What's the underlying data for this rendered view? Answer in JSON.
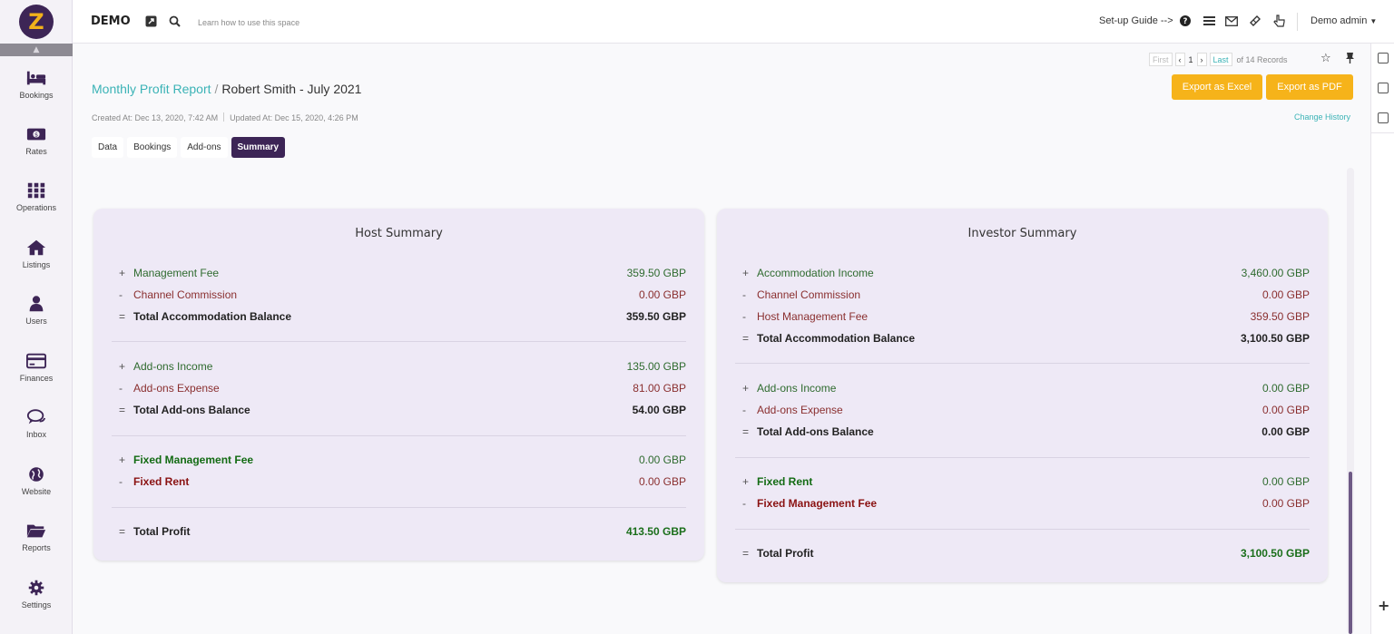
{
  "app": {
    "logo_letter": "Z",
    "name": "DEMO",
    "learn_text": "Learn how to use this space",
    "setup_guide": "Set-up Guide -->",
    "user": "Demo admin"
  },
  "sidebar": {
    "items": [
      {
        "label": "Bookings",
        "icon": "bed-icon"
      },
      {
        "label": "Rates",
        "icon": "money-icon"
      },
      {
        "label": "Operations",
        "icon": "grid-icon"
      },
      {
        "label": "Listings",
        "icon": "home-icon"
      },
      {
        "label": "Users",
        "icon": "user-icon"
      },
      {
        "label": "Finances",
        "icon": "credit-card-icon"
      },
      {
        "label": "Inbox",
        "icon": "chat-icon"
      },
      {
        "label": "Website",
        "icon": "globe-icon"
      },
      {
        "label": "Reports",
        "icon": "folder-icon"
      },
      {
        "label": "Settings",
        "icon": "gear-icon"
      }
    ]
  },
  "pager": {
    "first": "First",
    "page": "1",
    "last": "Last",
    "of": "of 14 Records"
  },
  "header": {
    "breadcrumb_link": "Monthly Profit Report",
    "breadcrumb_sep": "/",
    "breadcrumb_current": "Robert Smith - July 2021",
    "created": "Created At: Dec 13, 2020, 7:42 AM",
    "updated": "Updated At: Dec 15, 2020, 4:26 PM",
    "export_excel": "Export as Excel",
    "export_pdf": "Export as PDF",
    "change_history": "Change History"
  },
  "tabs": [
    "Data",
    "Bookings",
    "Add-ons",
    "Summary"
  ],
  "host": {
    "title": "Host Summary",
    "rows": [
      {
        "sign": "+",
        "label": "Management Fee",
        "amount": "359.50 GBP"
      },
      {
        "sign": "-",
        "label": "Channel Commission",
        "amount": "0.00 GBP"
      },
      {
        "sign": "=",
        "label": "Total Accommodation Balance",
        "amount": "359.50 GBP"
      },
      {
        "sign": "+",
        "label": "Add-ons Income",
        "amount": "135.00 GBP"
      },
      {
        "sign": "-",
        "label": "Add-ons Expense",
        "amount": "81.00 GBP"
      },
      {
        "sign": "=",
        "label": "Total Add-ons Balance",
        "amount": "54.00 GBP"
      },
      {
        "sign": "+",
        "label": "Fixed Management Fee",
        "amount": "0.00 GBP"
      },
      {
        "sign": "-",
        "label": "Fixed Rent",
        "amount": "0.00 GBP"
      },
      {
        "sign": "=",
        "label": "Total Profit",
        "amount": "413.50 GBP"
      }
    ]
  },
  "investor": {
    "title": "Investor Summary",
    "rows": [
      {
        "sign": "+",
        "label": "Accommodation Income",
        "amount": "3,460.00 GBP"
      },
      {
        "sign": "-",
        "label": "Channel Commission",
        "amount": "0.00 GBP"
      },
      {
        "sign": "-",
        "label": "Host Management Fee",
        "amount": "359.50 GBP"
      },
      {
        "sign": "=",
        "label": "Total Accommodation Balance",
        "amount": "3,100.50 GBP"
      },
      {
        "sign": "+",
        "label": "Add-ons Income",
        "amount": "0.00 GBP"
      },
      {
        "sign": "-",
        "label": "Add-ons Expense",
        "amount": "0.00 GBP"
      },
      {
        "sign": "=",
        "label": "Total Add-ons Balance",
        "amount": "0.00 GBP"
      },
      {
        "sign": "+",
        "label": "Fixed Rent",
        "amount": "0.00 GBP"
      },
      {
        "sign": "-",
        "label": "Fixed Management Fee",
        "amount": "0.00 GBP"
      },
      {
        "sign": "=",
        "label": "Total Profit",
        "amount": "3,100.50 GBP"
      }
    ]
  },
  "colors": {
    "brand": "#3d2556",
    "accent": "#f6b31a",
    "link": "#3bb3b6",
    "card_bg": "#eee9f6"
  }
}
